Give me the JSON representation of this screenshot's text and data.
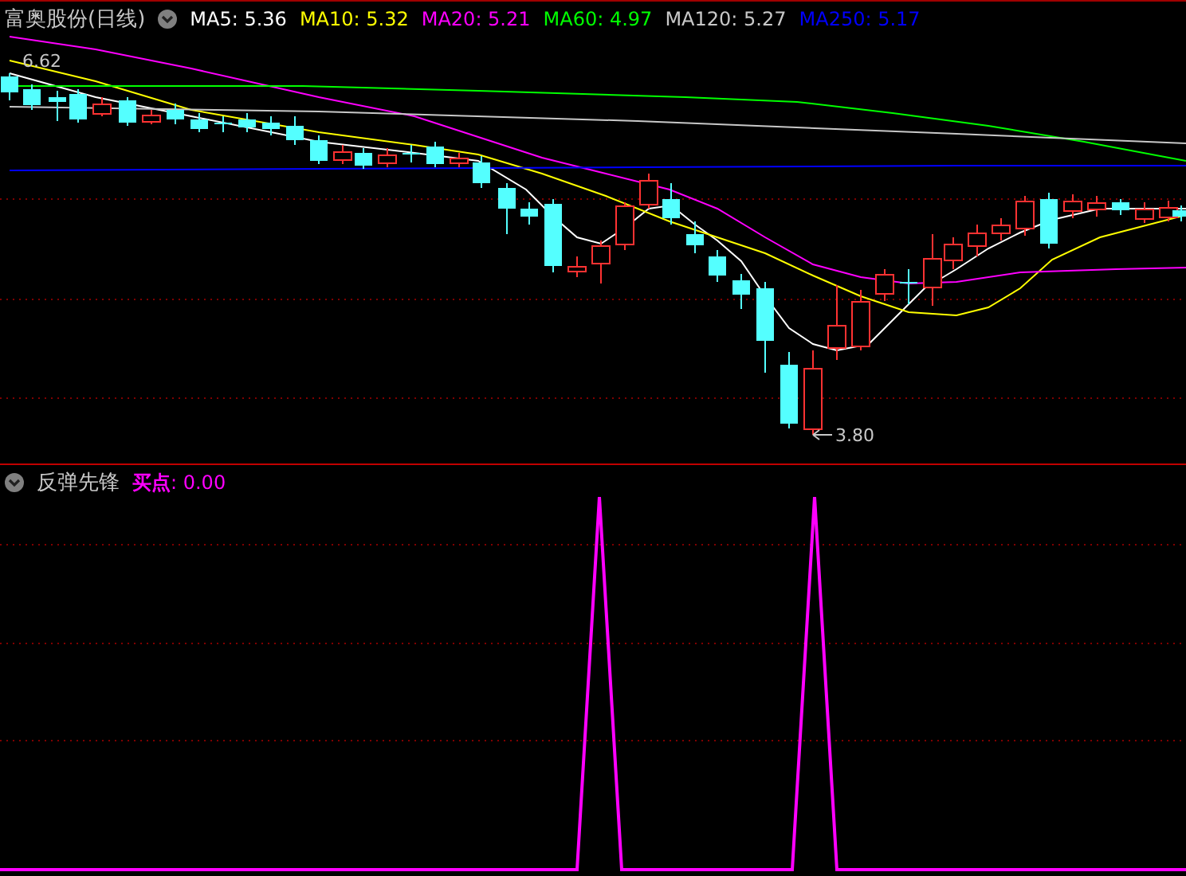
{
  "price_panel": {
    "title": "富奥股份(日线)",
    "moving_averages": [
      {
        "label": "MA5: 5.36",
        "color": "#ffffff"
      },
      {
        "label": "MA10: 5.32",
        "color": "#ffff00"
      },
      {
        "label": "MA20: 5.21",
        "color": "#ff00ff"
      },
      {
        "label": "MA60: 4.97",
        "color": "#00ff00"
      },
      {
        "label": "MA120: 5.27",
        "color": "#c8c8c8"
      },
      {
        "label": "MA250: 5.17",
        "color": "#0000ff"
      }
    ],
    "high_marker": "6.62",
    "low_marker": "3.80"
  },
  "indicator_panel": {
    "title": "反弹先锋",
    "readout": "**买点**: 0.00"
  }
}
